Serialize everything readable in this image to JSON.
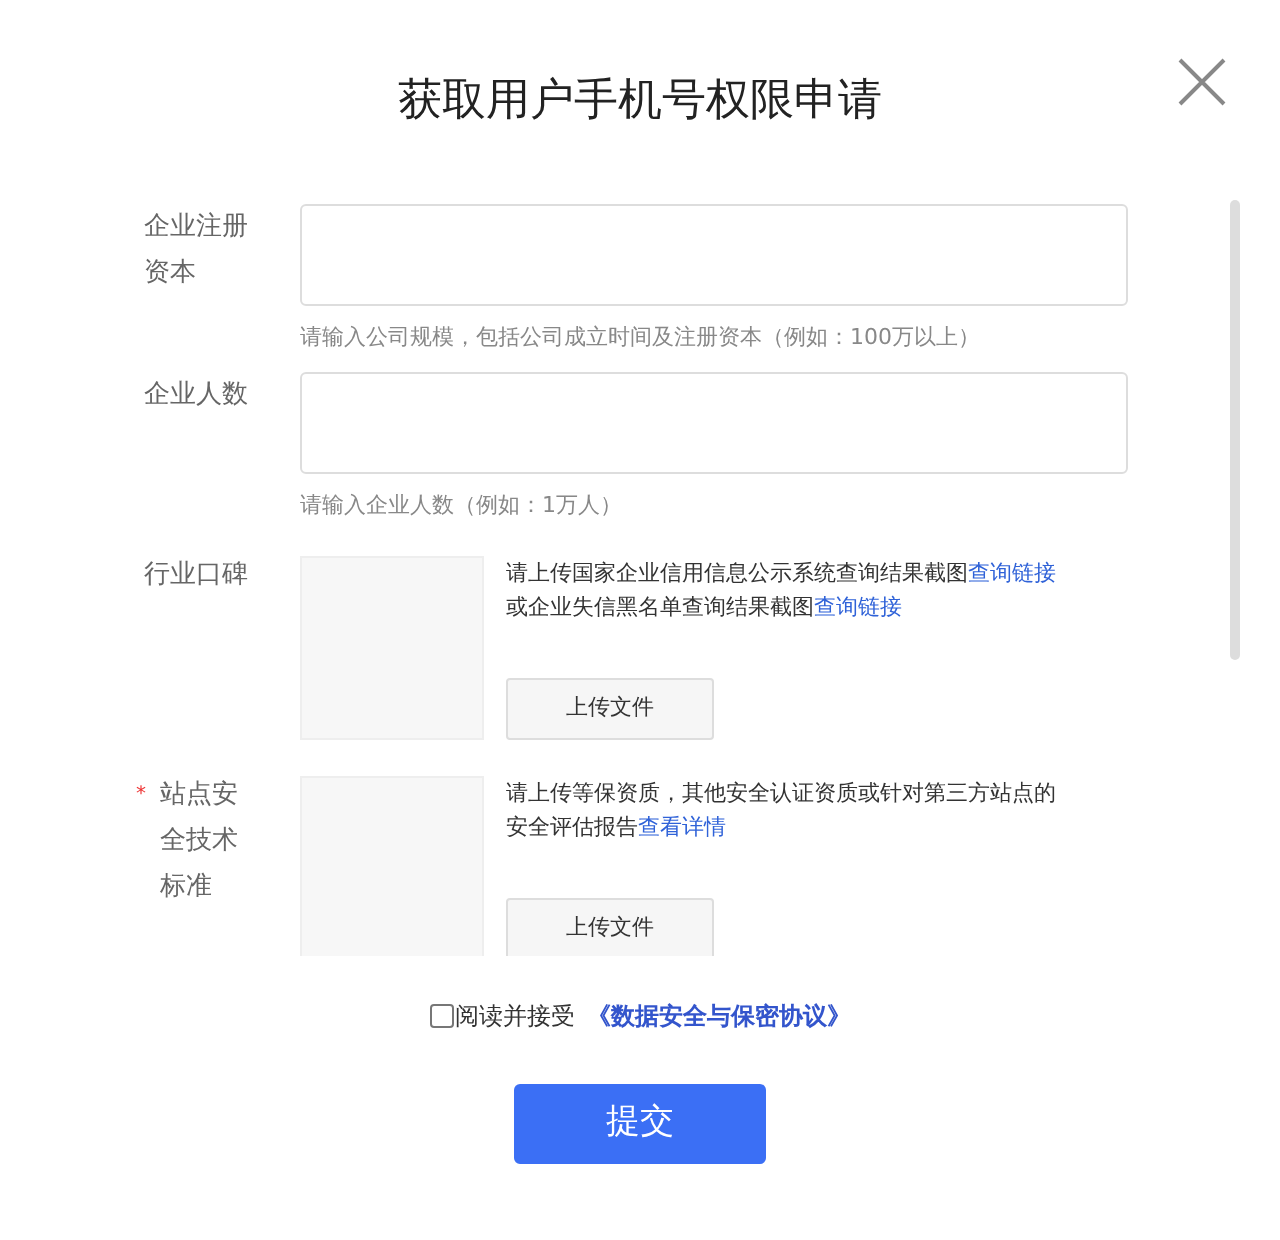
{
  "dialog": {
    "title": "获取用户手机号权限申请"
  },
  "fields": [
    {
      "kind": "text",
      "label": "企业注册资本",
      "hint": "请输入公司规模，包括公司成立时间及注册资本（例如：100万以上）"
    },
    {
      "kind": "text",
      "label": "企业人数",
      "hint": "请输入企业人数（例如：1万人）"
    },
    {
      "kind": "upload",
      "label": "行业口碑",
      "description": [
        {
          "text": "请上传国家企业信用信息公示系统查询结果截图",
          "link": false
        },
        {
          "text": "查询链接",
          "link": true
        },
        {
          "text": "或企业失信黑名单查询结果截图",
          "link": false
        },
        {
          "text": "查询链接",
          "link": true
        }
      ],
      "button": "上传文件"
    },
    {
      "kind": "upload",
      "label": "站点安全技术标准",
      "required_mark": "*",
      "description": [
        {
          "text": "请上传等保资质，其他安全认证资质或针对第三方站点的安全评估报告",
          "link": false
        },
        {
          "text": "查看详情",
          "link": true
        }
      ],
      "button": "上传文件"
    }
  ],
  "agreement": {
    "checked": false,
    "label": "阅读并接受",
    "link": "《数据安全与保密协议》"
  },
  "submit": "提交"
}
